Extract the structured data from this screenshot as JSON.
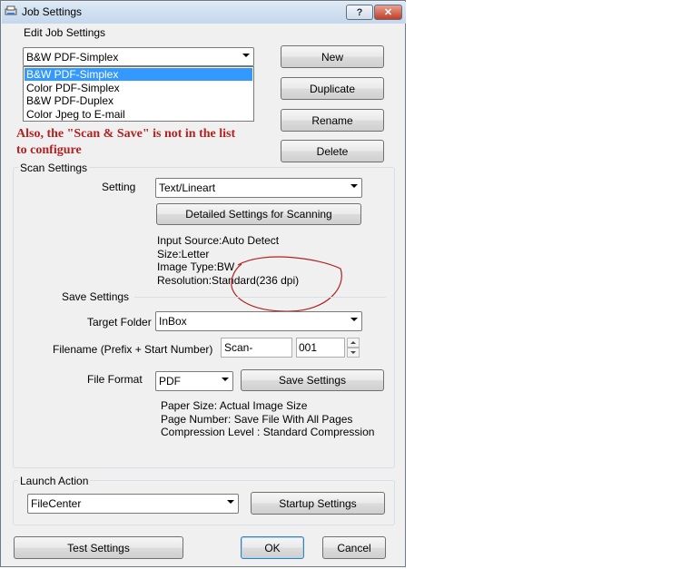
{
  "window": {
    "title": "Job Settings",
    "help_label": "?",
    "close_label": "✕"
  },
  "edit": {
    "label": "Edit Job Settings",
    "combo_value": "B&W PDF-Simplex",
    "list": [
      "B&W PDF-Simplex",
      "Color PDF-Simplex",
      "B&W PDF-Duplex",
      "Color Jpeg to E-mail"
    ],
    "selected_index": 0
  },
  "buttons": {
    "new": "New",
    "duplicate": "Duplicate",
    "rename": "Rename",
    "delete": "Delete"
  },
  "annotation": {
    "line1": "Also, the \"Scan & Save\" is not in the list",
    "line2": "to configure",
    "color": "#b22222"
  },
  "scan": {
    "group_label": "Scan Settings",
    "setting_label": "Setting",
    "setting_value": "Text/Lineart",
    "detailed_button": "Detailed Settings for Scanning",
    "info": [
      "Input Source:Auto Detect",
      "Size:Letter",
      "Image Type:BW",
      "Resolution:Standard(236 dpi)"
    ]
  },
  "save": {
    "group_label": "Save Settings",
    "target_label": "Target Folder",
    "target_value": "InBox",
    "filename_label": "Filename (Prefix + Start Number)",
    "prefix_value": "Scan-",
    "start_number": "001",
    "format_label": "File Format",
    "format_value": "PDF",
    "save_settings_button": "Save Settings",
    "info": [
      "Paper Size: Actual Image Size",
      "Page Number: Save File With All Pages",
      "Compression Level : Standard Compression"
    ]
  },
  "launch": {
    "group_label": "Launch Action",
    "value": "FileCenter",
    "startup_button": "Startup Settings"
  },
  "footer": {
    "test_button": "Test Settings",
    "ok_button": "OK",
    "cancel_button": "Cancel"
  }
}
